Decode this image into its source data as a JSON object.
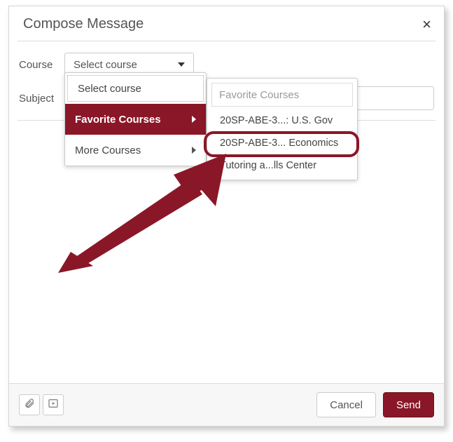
{
  "dialog": {
    "title": "Compose Message",
    "close_glyph": "×"
  },
  "form": {
    "course_label": "Course",
    "subject_label": "Subject",
    "course_select_placeholder": "Select course"
  },
  "dropdown1": {
    "items": [
      {
        "label": "Select course"
      },
      {
        "label": "Favorite Courses"
      },
      {
        "label": "More Courses"
      }
    ]
  },
  "dropdown2": {
    "header": "Favorite Courses",
    "items": [
      {
        "label": "20SP-ABE-3...: U.S. Gov"
      },
      {
        "label": "20SP-ABE-3... Economics"
      },
      {
        "label": "Tutoring a...lls Center"
      }
    ]
  },
  "footer": {
    "cancel_label": "Cancel",
    "send_label": "Send"
  },
  "colors": {
    "brand": "#8a1727"
  }
}
